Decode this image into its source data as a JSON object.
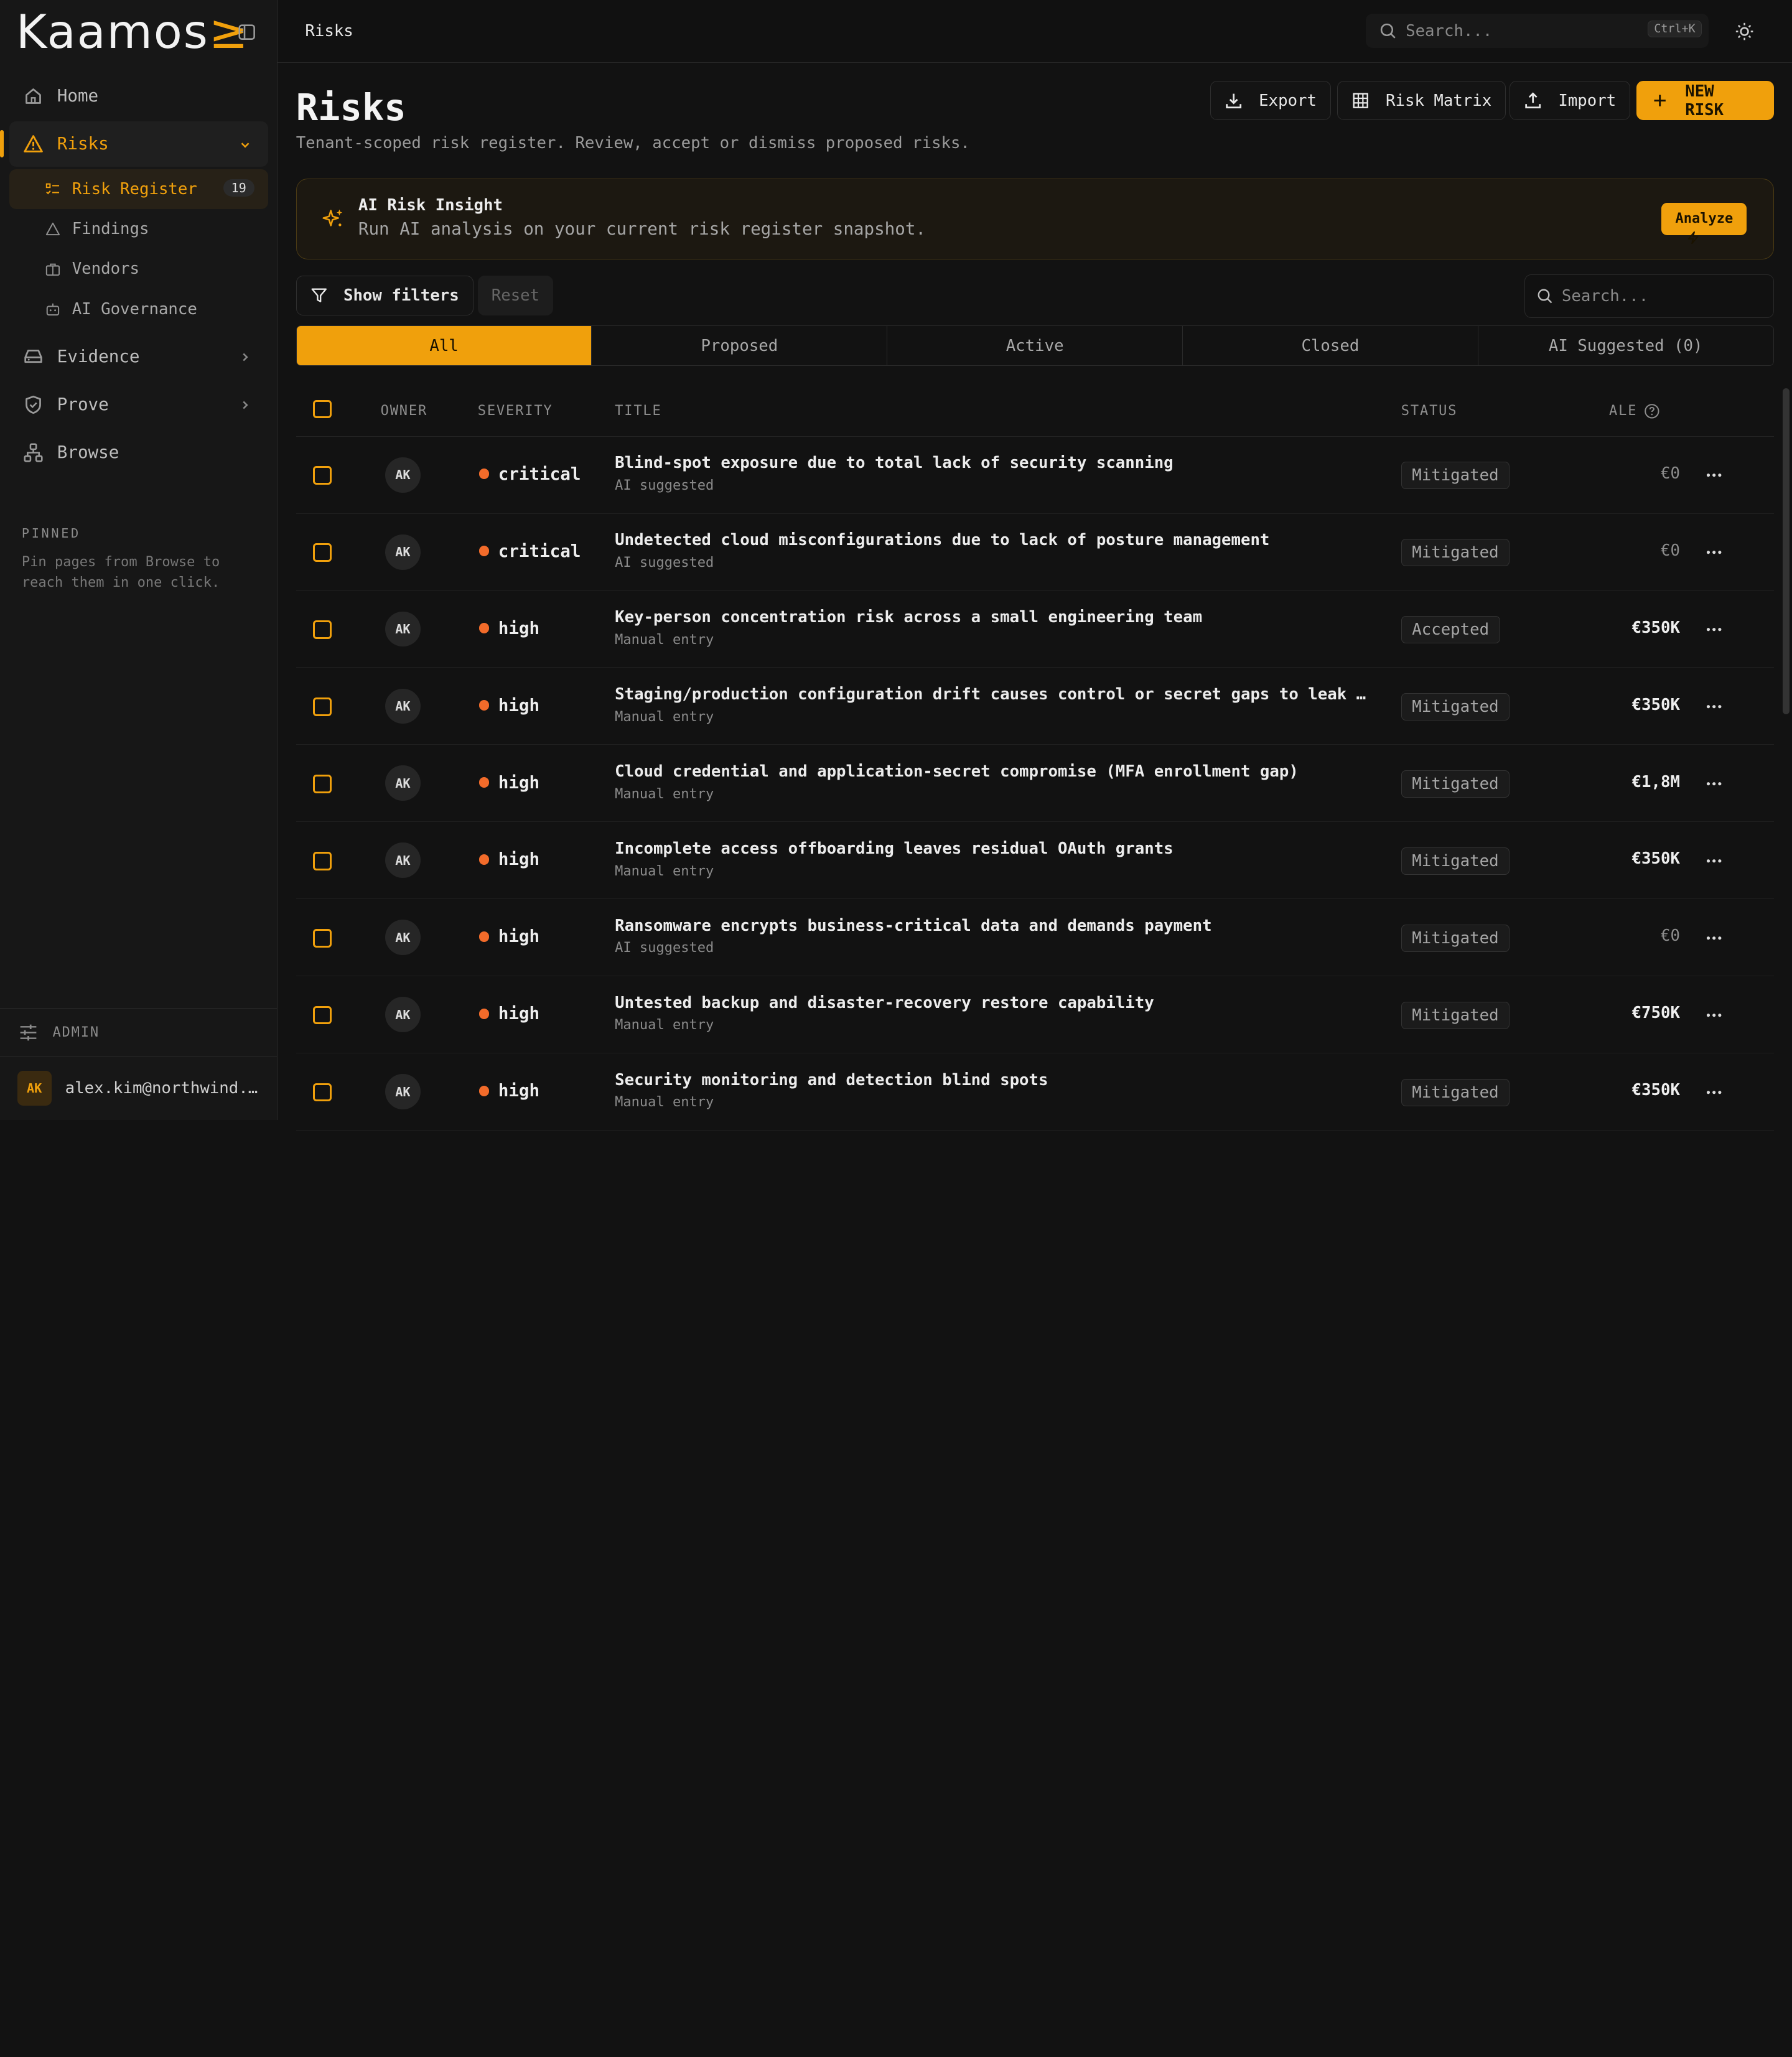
{
  "brand": {
    "name": "Kaamos",
    "mark": "≥"
  },
  "sidebar": {
    "items": [
      {
        "label": "Home"
      },
      {
        "label": "Risks"
      },
      {
        "label": "Evidence"
      },
      {
        "label": "Prove"
      },
      {
        "label": "Browse"
      }
    ],
    "risk_sub": [
      {
        "label": "Risk Register",
        "count": "19"
      },
      {
        "label": "Findings"
      },
      {
        "label": "Vendors"
      },
      {
        "label": "AI Governance"
      }
    ],
    "pinned_title": "PINNED",
    "pinned_text": "Pin pages from Browse to reach them in one click.",
    "admin_label": "ADMIN",
    "user_initials": "AK",
    "user_email": "alex.kim@northwind.e…"
  },
  "topbar": {
    "breadcrumb": "Risks",
    "search_placeholder": "Search...",
    "shortcut": "Ctrl+K"
  },
  "page": {
    "title": "Risks",
    "subtitle": "Tenant-scoped risk register. Review, accept or dismiss proposed risks.",
    "actions": {
      "export": "Export",
      "matrix": "Risk Matrix",
      "import": "Import",
      "new": "NEW RISK"
    }
  },
  "insight": {
    "title": "AI Risk Insight",
    "text": "Run AI analysis on your current risk register snapshot.",
    "button": "Analyze"
  },
  "filters": {
    "show": "Show filters",
    "reset": "Reset",
    "search_placeholder": "Search..."
  },
  "tabs": [
    "All",
    "Proposed",
    "Active",
    "Closed",
    "AI Suggested (0)"
  ],
  "table": {
    "headers": {
      "owner": "OWNER",
      "severity": "SEVERITY",
      "title": "TITLE",
      "status": "STATUS",
      "ale": "ALE"
    },
    "rows": [
      {
        "owner": "AK",
        "severity": "critical",
        "title": "Blind-spot exposure due to total lack of security scanning",
        "source": "AI suggested",
        "status": "Mitigated",
        "ale": "€0"
      },
      {
        "owner": "AK",
        "severity": "critical",
        "title": "Undetected cloud misconfigurations due to lack of posture management",
        "source": "AI suggested",
        "status": "Mitigated",
        "ale": "€0"
      },
      {
        "owner": "AK",
        "severity": "high",
        "title": "Key-person concentration risk across a small engineering team",
        "source": "Manual entry",
        "status": "Accepted",
        "ale": "€350K"
      },
      {
        "owner": "AK",
        "severity": "high",
        "title": "Staging/production configuration drift causes control or secret gaps to leak into…",
        "source": "Manual entry",
        "status": "Mitigated",
        "ale": "€350K"
      },
      {
        "owner": "AK",
        "severity": "high",
        "title": "Cloud credential and application-secret compromise (MFA enrollment gap)",
        "source": "Manual entry",
        "status": "Mitigated",
        "ale": "€1,8M"
      },
      {
        "owner": "AK",
        "severity": "high",
        "title": "Incomplete access offboarding leaves residual OAuth grants",
        "source": "Manual entry",
        "status": "Mitigated",
        "ale": "€350K"
      },
      {
        "owner": "AK",
        "severity": "high",
        "title": "Ransomware encrypts business-critical data and demands payment",
        "source": "AI suggested",
        "status": "Mitigated",
        "ale": "€0"
      },
      {
        "owner": "AK",
        "severity": "high",
        "title": "Untested backup and disaster-recovery restore capability",
        "source": "Manual entry",
        "status": "Mitigated",
        "ale": "€750K"
      },
      {
        "owner": "AK",
        "severity": "high",
        "title": "Security monitoring and detection blind spots",
        "source": "Manual entry",
        "status": "Mitigated",
        "ale": "€350K"
      }
    ]
  },
  "colors": {
    "accent": "#f0a00c",
    "severity_dot": "#f26b2a",
    "background": "#121212"
  }
}
